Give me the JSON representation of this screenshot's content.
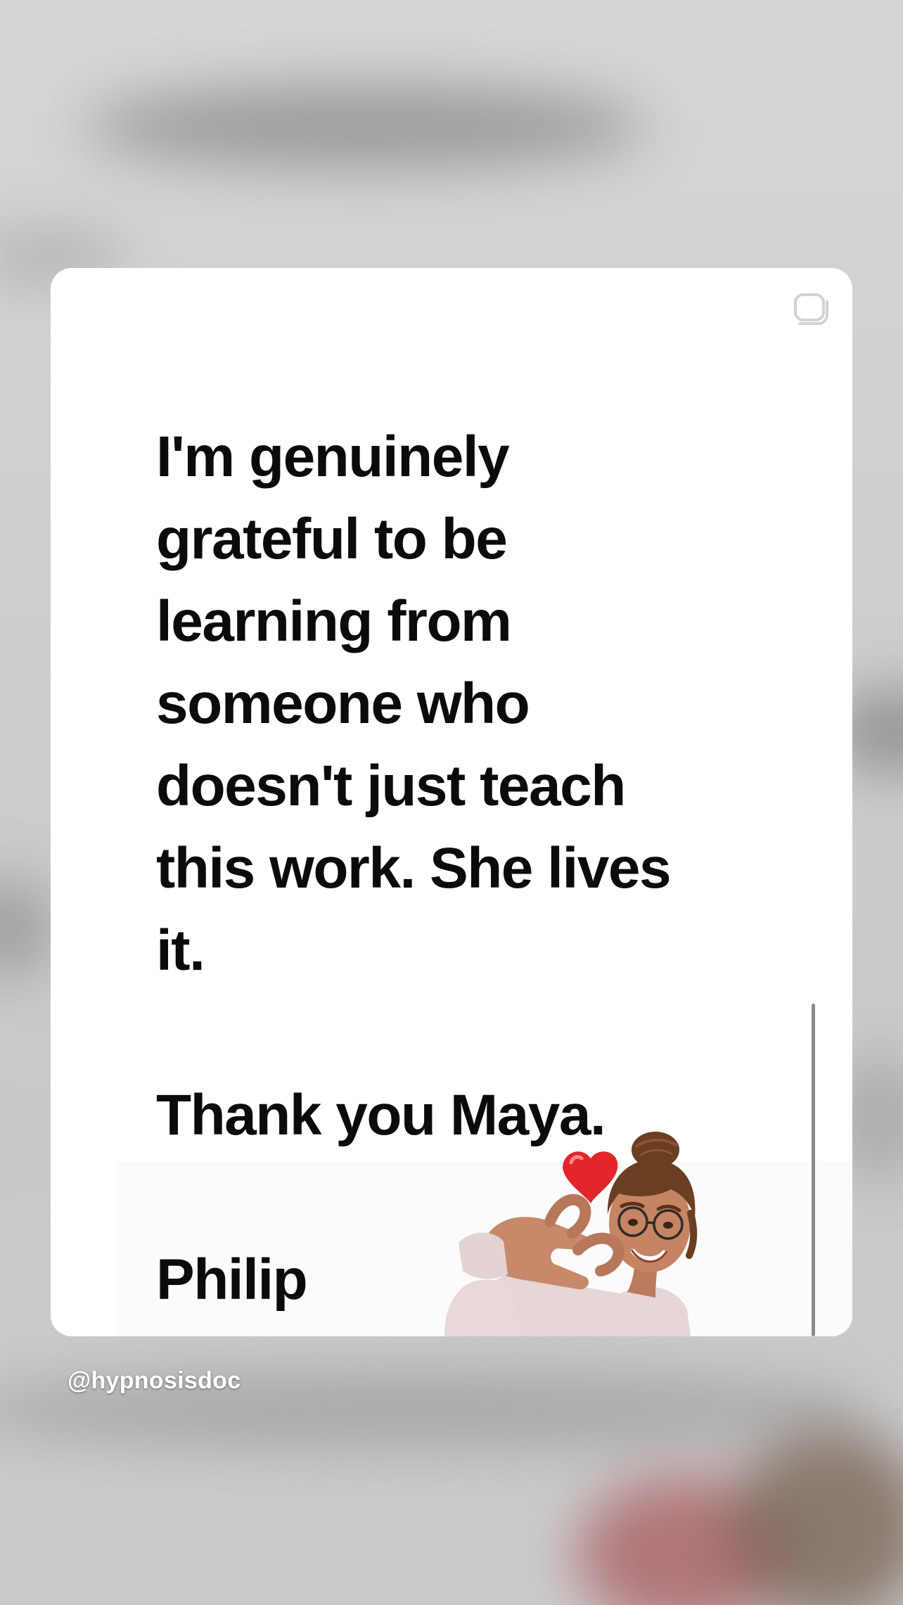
{
  "story": {
    "message_lines": [
      "I'm genuinely",
      "grateful to be",
      "learning from",
      "someone who",
      "doesn't just teach",
      "this work. She lives",
      "it.",
      "",
      "Thank you Maya.",
      "",
      "Philip"
    ],
    "message": "I'm genuinely\ngrateful to be\nlearning from\nsomeone who\ndoesn't just teach\nthis work. She lives\nit.\n\nThank you Maya.\n\nPhilip",
    "username": "@hypnosisdoc",
    "sticker": "memoji-heart-hands-sticker",
    "copy_icon": "copy-icon"
  },
  "colors": {
    "card_background": "#ffffff",
    "text": "#0b0b0b",
    "heart": "#e3262b",
    "username_text": "#ffffff"
  }
}
